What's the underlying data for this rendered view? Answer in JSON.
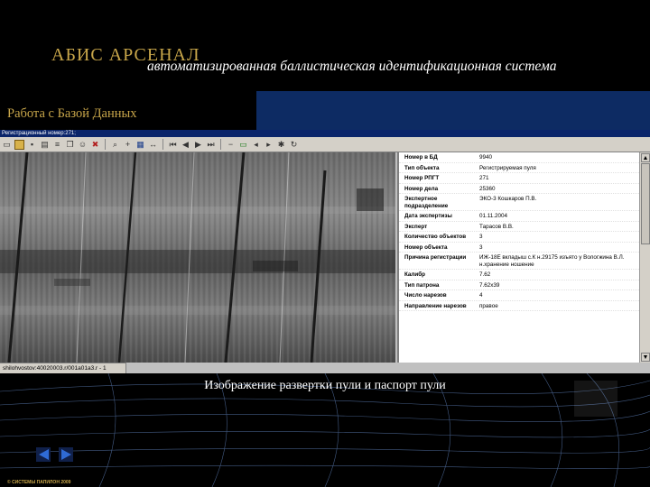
{
  "header": {
    "brand_title": "АБИС АРСЕНАЛ",
    "subtitle": "автоматизированная баллистическая идентификационная система",
    "section_label": "Работа с Базой Данных"
  },
  "app": {
    "window_title": "Регистрационный номер:271;",
    "status_path": "shilohvostov:40020003.r/001a01a3.r - 1"
  },
  "passport": {
    "rows": [
      {
        "key": "Номер в БД",
        "value": "9940"
      },
      {
        "key": "Тип объекта",
        "value": "Регистрируемая пуля"
      },
      {
        "key": "Номер РПГТ",
        "value": "271"
      },
      {
        "key": "Номер дела",
        "value": "25360"
      },
      {
        "key": "Экспертное подразделение",
        "value": "ЭКО-3 Кошкаров П.В."
      },
      {
        "key": "Дата экспертизы",
        "value": "01.11.2004"
      },
      {
        "key": "Эксперт",
        "value": "Тарасов В.В."
      },
      {
        "key": "Количество объектов",
        "value": "3"
      },
      {
        "key": "Номер объекта",
        "value": "3"
      },
      {
        "key": "Причина регистрации",
        "value": "ИЖ-18Е вкладыш с.К н.29175 изъято у Вологжина В.Л. н.хранение ношение"
      },
      {
        "key": "Калибр",
        "value": "7.62"
      },
      {
        "key": "Тип патрона",
        "value": "7.62х39"
      },
      {
        "key": "Число нарезов",
        "value": "4"
      },
      {
        "key": "Направление нарезов",
        "value": "правое"
      }
    ]
  },
  "caption": "Изображение развертки пули и паспорт пули",
  "copyright": "© СИСТЕМЫ ПАПИЛОН 2009",
  "colors": {
    "gold": "#c8a64a",
    "nav_blue": "#2f6bd6",
    "band_blue": "#0d2b63"
  }
}
